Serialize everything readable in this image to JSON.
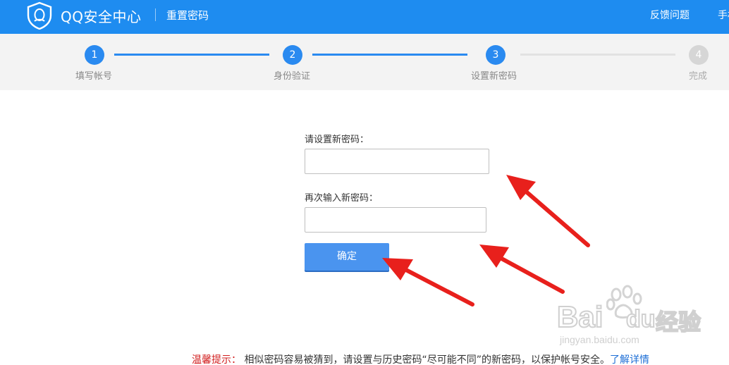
{
  "header": {
    "brand": "QQ安全中心",
    "page_title": "重置密码",
    "nav_feedback": "反馈问题",
    "nav_mobile": "手机"
  },
  "steps": [
    {
      "num": "1",
      "label": "填写帐号",
      "state": "done"
    },
    {
      "num": "2",
      "label": "身份验证",
      "state": "done"
    },
    {
      "num": "3",
      "label": "设置新密码",
      "state": "current"
    },
    {
      "num": "4",
      "label": "完成",
      "state": "todo"
    }
  ],
  "form": {
    "new_password_label": "请设置新密码：",
    "new_password_value": "",
    "confirm_password_label": "再次输入新密码：",
    "confirm_password_value": "",
    "submit_label": "确定"
  },
  "tip": {
    "title": "温馨提示：",
    "body": " 相似密码容易被猜到，请设置与历史密码“尽可能不同”的新密码，以保护帐号安全。",
    "link": "了解详情"
  },
  "watermark": {
    "brand": "Bai",
    "brand_tail": "du",
    "cn": "经验",
    "url": "jingyan.baidu.com"
  },
  "colors": {
    "header_bg": "#1e8cf0",
    "accent": "#2a8af0",
    "annotation_arrow": "#e8201c",
    "tip_title": "#d11d1d"
  }
}
